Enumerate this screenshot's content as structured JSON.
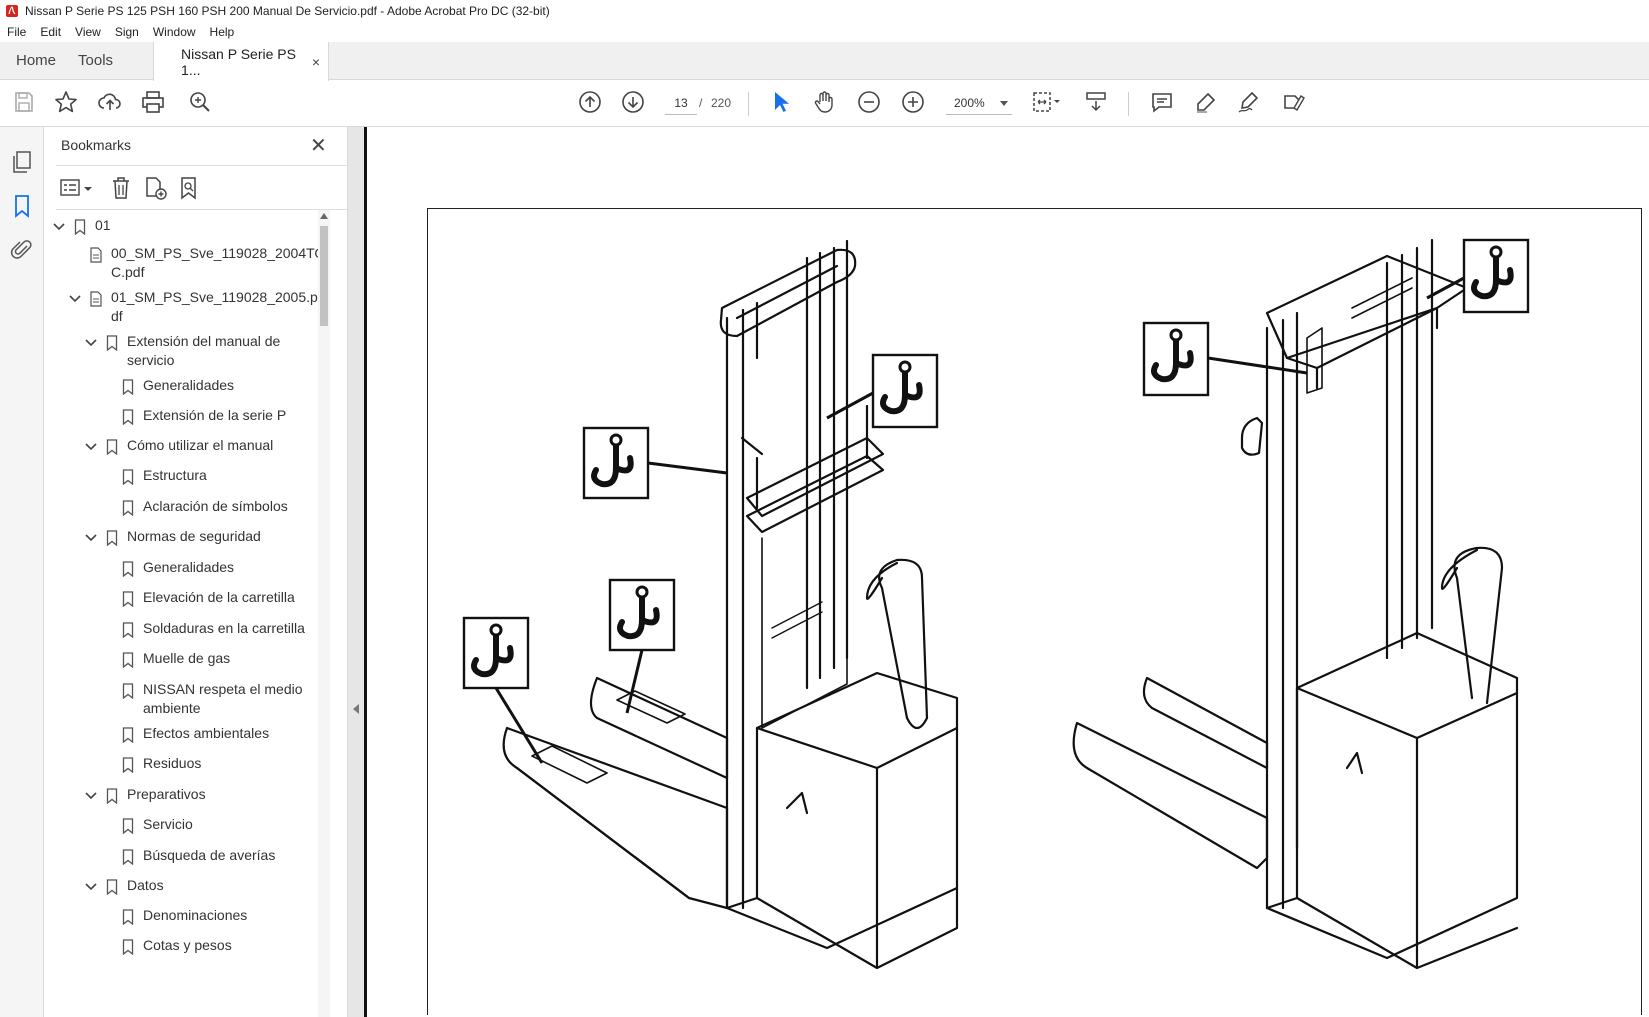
{
  "window": {
    "title": "Nissan P Serie PS 125 PSH 160 PSH 200 Manual De Servicio.pdf - Adobe Acrobat Pro DC (32-bit)",
    "accent_color": "#1473e6",
    "app_icon": "acrobat-icon"
  },
  "menu": {
    "items": [
      "File",
      "Edit",
      "View",
      "Sign",
      "Window",
      "Help"
    ]
  },
  "tabs": {
    "home": "Home",
    "tools": "Tools",
    "document": "Nissan P Serie PS 1...",
    "close": "×"
  },
  "toolbar": {
    "current_page": "13",
    "separator": "/",
    "total_pages": "220",
    "zoom": "200%",
    "icons": [
      "save-icon",
      "star-icon",
      "upload-icon",
      "print-icon",
      "search-zoom-icon",
      "page-up-icon",
      "page-down-icon",
      "select-cursor-icon",
      "hand-icon",
      "zoom-out-icon",
      "zoom-in-icon",
      "fit-page-icon",
      "scroll-mode-icon",
      "comment-icon",
      "highlight-icon",
      "sign-icon",
      "fill-sign-icon"
    ]
  },
  "bookmarks": {
    "title": "Bookmarks",
    "close": "✕",
    "items": [
      {
        "label": "01",
        "level": 0,
        "expanded": true,
        "kind": "bookmark"
      },
      {
        "label": "00_SM_PS_Sve_119028_2004TO",
        "label2": "C.pdf",
        "level": 1,
        "kind": "file"
      },
      {
        "label": "01_SM_PS_Sve_119028_2005.p",
        "label2": "df",
        "level": 1,
        "expanded": true,
        "kind": "file"
      },
      {
        "label": "Extensión del manual de",
        "label2": "servicio",
        "level": 2,
        "expanded": true,
        "kind": "bookmark"
      },
      {
        "label": "Generalidades",
        "level": 3,
        "kind": "bookmark"
      },
      {
        "label": "Extensión de la serie P",
        "level": 3,
        "kind": "bookmark"
      },
      {
        "label": "Cómo utilizar el manual",
        "level": 2,
        "expanded": true,
        "kind": "bookmark"
      },
      {
        "label": "Estructura",
        "level": 3,
        "kind": "bookmark"
      },
      {
        "label": "Aclaración de símbolos",
        "level": 3,
        "kind": "bookmark"
      },
      {
        "label": "Normas de seguridad",
        "level": 2,
        "expanded": true,
        "kind": "bookmark"
      },
      {
        "label": "Generalidades",
        "level": 3,
        "kind": "bookmark"
      },
      {
        "label": "Elevación de la carretilla",
        "level": 3,
        "kind": "bookmark"
      },
      {
        "label": "Soldaduras en la carretilla",
        "level": 3,
        "kind": "bookmark"
      },
      {
        "label": "Muelle de gas",
        "level": 3,
        "kind": "bookmark"
      },
      {
        "label": "NISSAN respeta el medio",
        "label2": "ambiente",
        "level": 3,
        "kind": "bookmark"
      },
      {
        "label": "Efectos ambientales",
        "level": 3,
        "kind": "bookmark"
      },
      {
        "label": "Residuos",
        "level": 3,
        "kind": "bookmark"
      },
      {
        "label": "Preparativos",
        "level": 2,
        "expanded": true,
        "kind": "bookmark"
      },
      {
        "label": "Servicio",
        "level": 3,
        "kind": "bookmark"
      },
      {
        "label": "Búsqueda de averías",
        "level": 3,
        "kind": "bookmark"
      },
      {
        "label": "Datos",
        "level": 2,
        "expanded": true,
        "kind": "bookmark"
      },
      {
        "label": "Denominaciones",
        "level": 3,
        "kind": "bookmark"
      },
      {
        "label": "Cotas y pesos",
        "level": 3,
        "kind": "bookmark"
      }
    ]
  },
  "document": {
    "illustration": "two-pallet-stackers-with-lifting-hook-points"
  }
}
